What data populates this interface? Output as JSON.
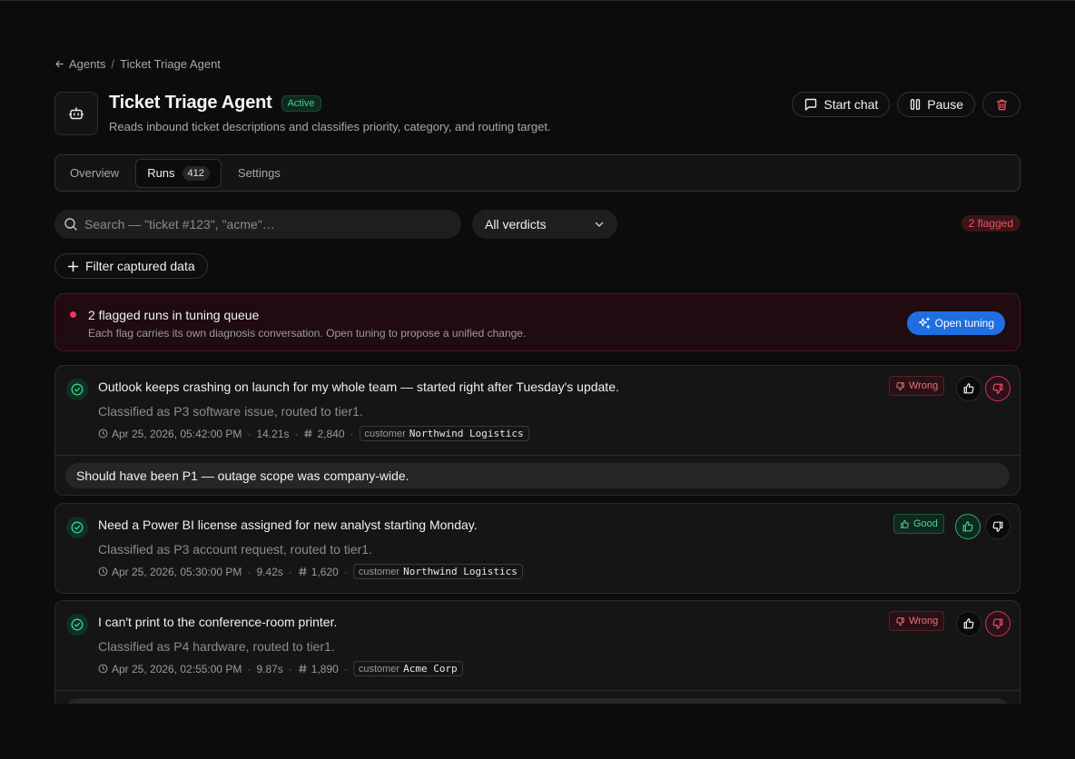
{
  "breadcrumb": {
    "parent": "Agents",
    "separator": "/",
    "current": "Ticket Triage Agent"
  },
  "agent": {
    "name": "Ticket Triage Agent",
    "status": "Active",
    "description": "Reads inbound ticket descriptions and classifies priority, category, and routing target.",
    "icon": "bot-icon"
  },
  "actions": {
    "start_chat": "Start chat",
    "pause": "Pause",
    "delete_icon": "trash-icon"
  },
  "tabs": [
    {
      "label": "Overview"
    },
    {
      "label": "Runs",
      "count": "412",
      "active": true
    },
    {
      "label": "Settings"
    }
  ],
  "search": {
    "placeholder": "Search — \"ticket #123\", \"acme\"…",
    "value": ""
  },
  "verdict_filter": {
    "selected": "All verdicts"
  },
  "flagged_count": "2 flagged",
  "filter_captured": "Filter captured data",
  "banner": {
    "title": "2 flagged runs in tuning queue",
    "subtitle": "Each flag carries its own diagnosis conversation. Open tuning to propose a unified change.",
    "button": "Open tuning"
  },
  "runs": [
    {
      "title": "Outlook keeps crashing on launch for my whole team — started right after Tuesday's update.",
      "summary": "Classified as P3 software issue, routed to tier1.",
      "time": "Apr 25, 2026, 05:42:00 PM",
      "duration": "14.21s",
      "tokens": "2,840",
      "tag_key": "customer",
      "tag_value": "Northwind Logistics",
      "verdict": "Wrong",
      "note": "Should have been P1 — outage scope was company-wide."
    },
    {
      "title": "Need a Power BI license assigned for new analyst starting Monday.",
      "summary": "Classified as P3 account request, routed to tier1.",
      "time": "Apr 25, 2026, 05:30:00 PM",
      "duration": "9.42s",
      "tokens": "1,620",
      "tag_key": "customer",
      "tag_value": "Northwind Logistics",
      "verdict": "Good"
    },
    {
      "title": "I can't print to the conference-room printer.",
      "summary": "Classified as P4 hardware, routed to tier1.",
      "time": "Apr 25, 2026, 02:55:00 PM",
      "duration": "9.87s",
      "tokens": "1,890",
      "tag_key": "customer",
      "tag_value": "Acme Corp",
      "verdict": "Wrong"
    }
  ],
  "colors": {
    "accent": "#1f6fe0",
    "good": "#4cd492",
    "wrong": "#e8707a",
    "flag": "#f0345a"
  }
}
